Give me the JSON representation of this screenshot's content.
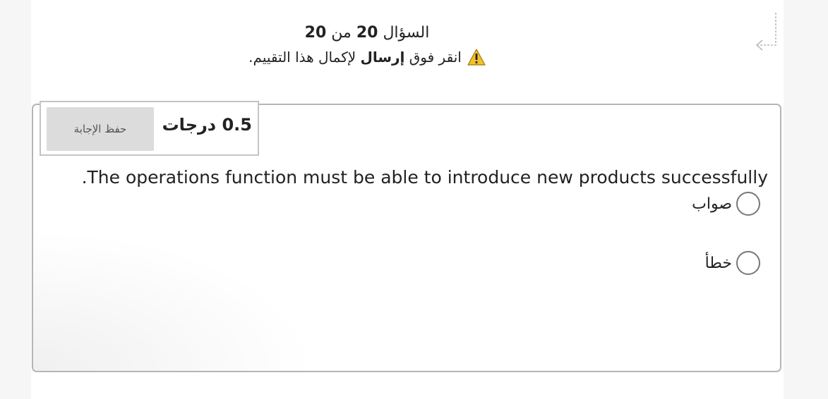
{
  "header": {
    "question_prefix": "السؤال",
    "question_number": "20",
    "question_of": "من",
    "question_total": "20",
    "note_before": "انقر فوق",
    "note_bold": "إرسال",
    "note_after": "لإكمال هذا التقييم."
  },
  "card": {
    "points_label": "0.5 درجات",
    "save_label": "حفظ الإجابة",
    "question_text": "The operations function must be able to introduce new products successfully.",
    "options": [
      {
        "label": "صواب"
      },
      {
        "label": "خطأ"
      }
    ]
  },
  "icons": {
    "warning": "warning-triangle-icon",
    "back": "return-arrow-icon"
  },
  "colors": {
    "warning_fill": "#f2c12e",
    "border": "#b5b5b5",
    "button_bg": "#dcdcdc"
  }
}
